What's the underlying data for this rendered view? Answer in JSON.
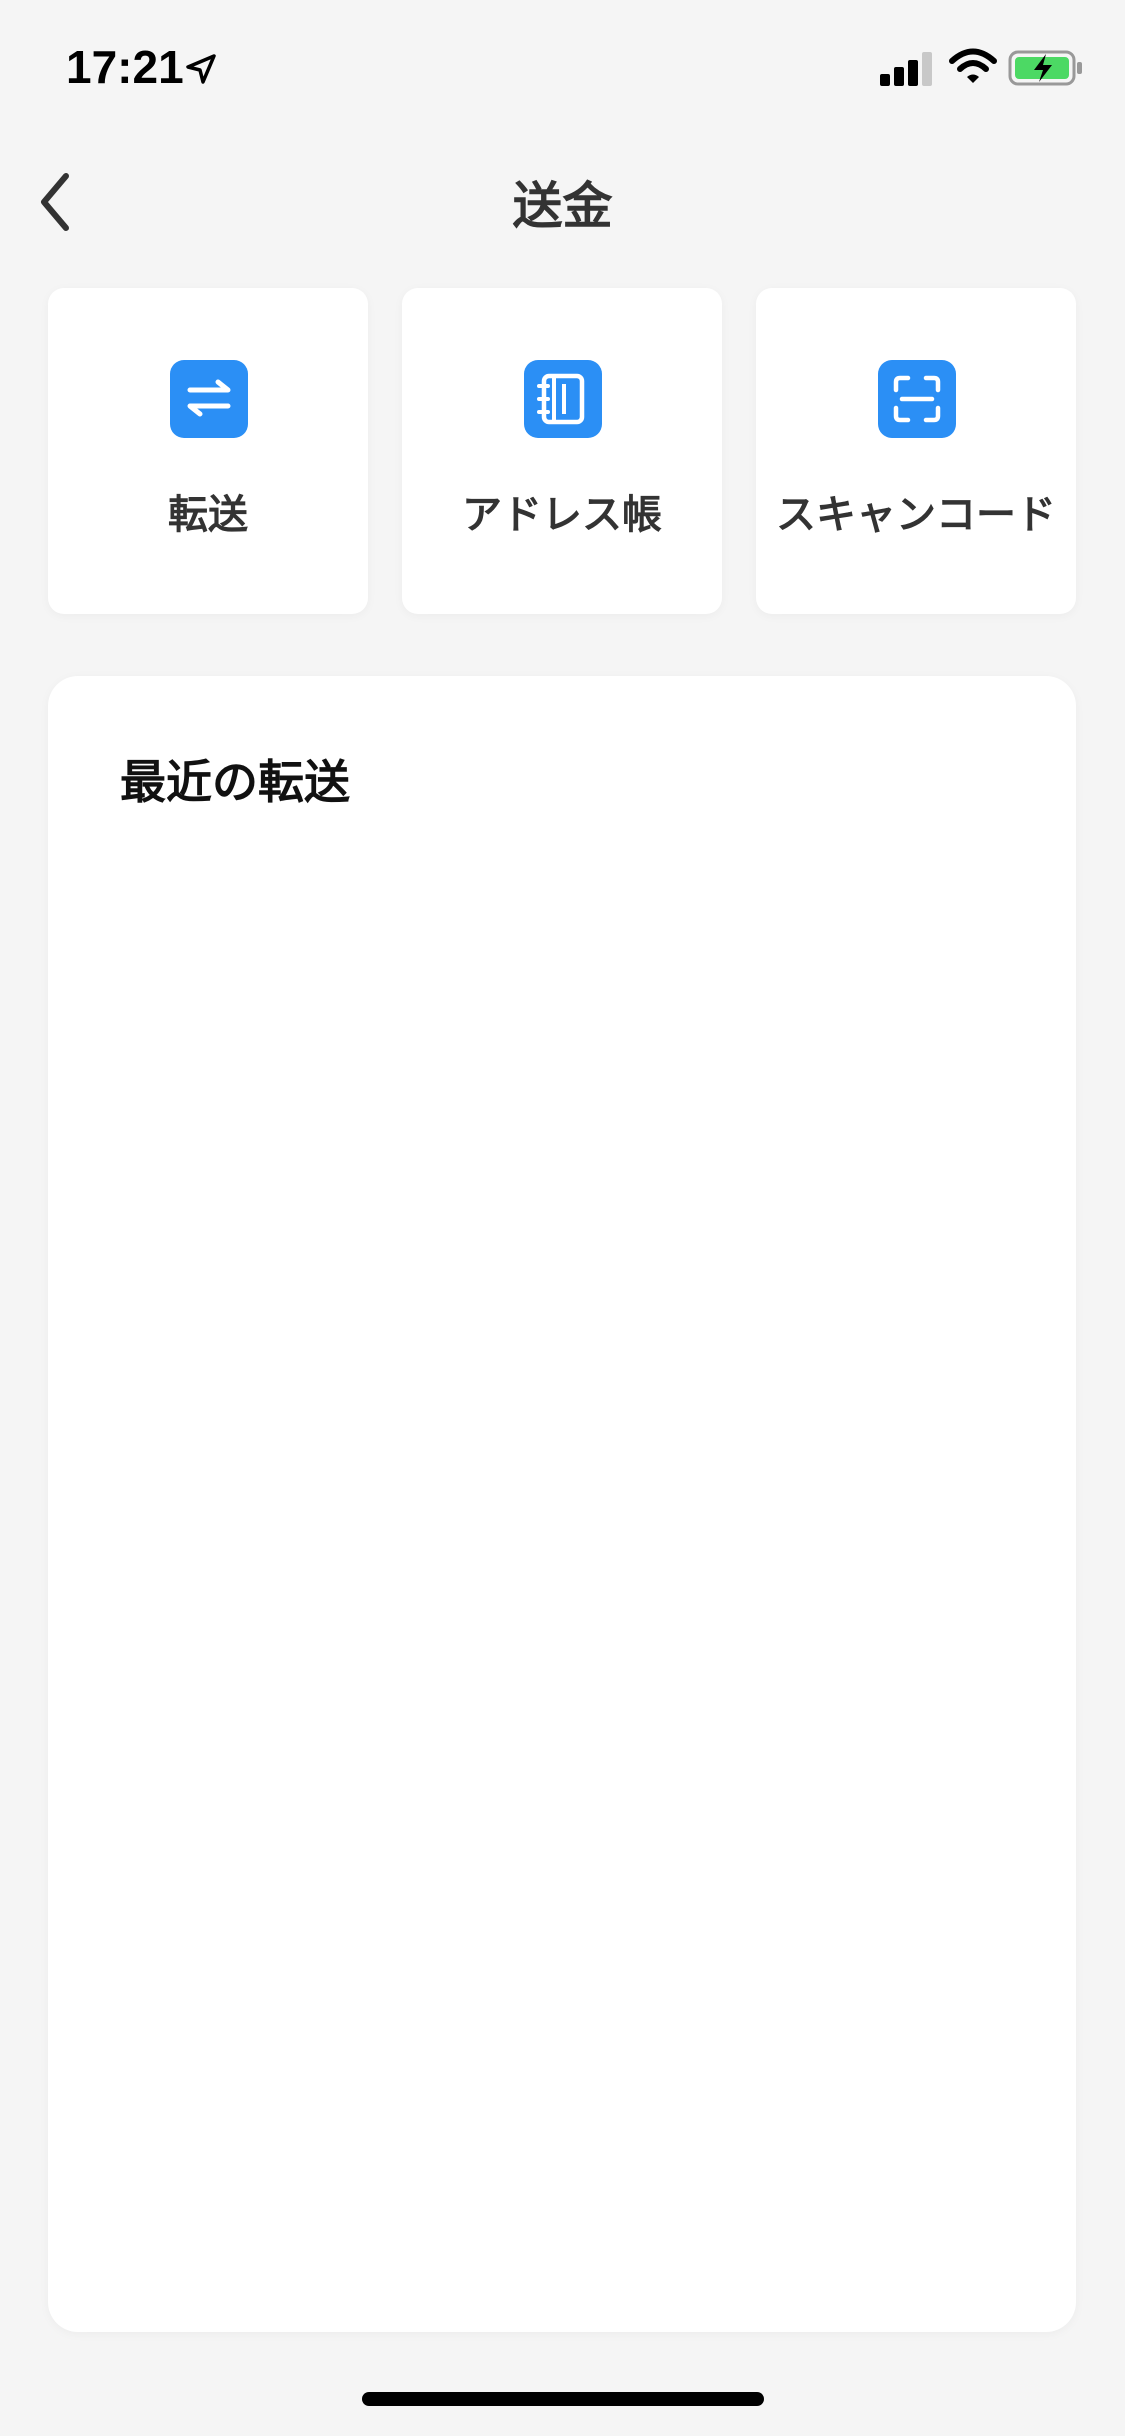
{
  "status_bar": {
    "time": "17:21",
    "icons": [
      "location-arrow-icon",
      "cellular-signal-icon",
      "wifi-icon",
      "battery-charging-icon"
    ],
    "battery_color": "#4cd964"
  },
  "nav": {
    "title": "送金",
    "back_icon": "chevron-left-icon"
  },
  "actions": [
    {
      "label": "転送",
      "icon": "transfer-arrows-icon"
    },
    {
      "label": "アドレス帳",
      "icon": "address-book-icon"
    },
    {
      "label": "スキャンコード",
      "icon": "scan-code-icon"
    }
  ],
  "recent": {
    "title": "最近の転送"
  },
  "colors": {
    "accent": "#2b8ff5",
    "background": "#f5f5f5",
    "card": "#ffffff",
    "text": "#333333"
  }
}
